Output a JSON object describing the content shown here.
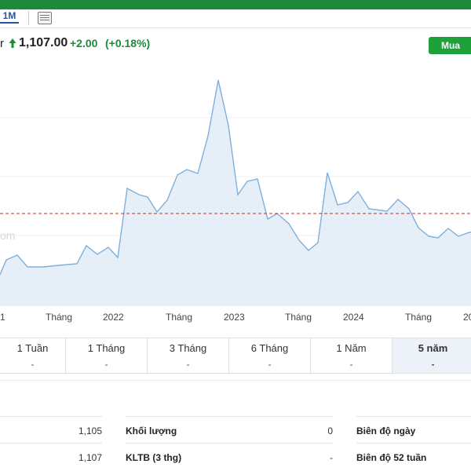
{
  "toolbar": {
    "range_label": "1M"
  },
  "quote": {
    "ticker_tail": "r",
    "price": "1,107.00",
    "change": "+2.00",
    "change_pct": "(+0.18%)",
    "up_color": "#1c8a3a"
  },
  "buy_button": {
    "label": "Mua"
  },
  "chart_data": {
    "type": "area",
    "x_tick_labels": [
      "1",
      "Tháng",
      "2022",
      "Tháng",
      "2023",
      "Tháng",
      "2024",
      "Tháng",
      "20"
    ],
    "watermark": "om",
    "reference_line_color": "#c62828",
    "series_color": "#7fb0dc",
    "fill_color": "#e6eef7",
    "grid": true
  },
  "periods": [
    {
      "label": "1 Tuần",
      "value": "-",
      "active": false
    },
    {
      "label": "1 Tháng",
      "value": "-",
      "active": false
    },
    {
      "label": "3 Tháng",
      "value": "-",
      "active": false
    },
    {
      "label": "6 Tháng",
      "value": "-",
      "active": false
    },
    {
      "label": "1 Năm",
      "value": "-",
      "active": false
    },
    {
      "label": "5 năm",
      "value": "-",
      "active": true
    }
  ],
  "stats": [
    {
      "left_value": "1,105",
      "label": "Khối lượng",
      "value": "0",
      "right_label": "Biên độ ngày"
    },
    {
      "left_value": "1,107",
      "label": "KLTB (3 thg)",
      "value": "-",
      "right_label": "Biên độ 52 tuần"
    }
  ]
}
